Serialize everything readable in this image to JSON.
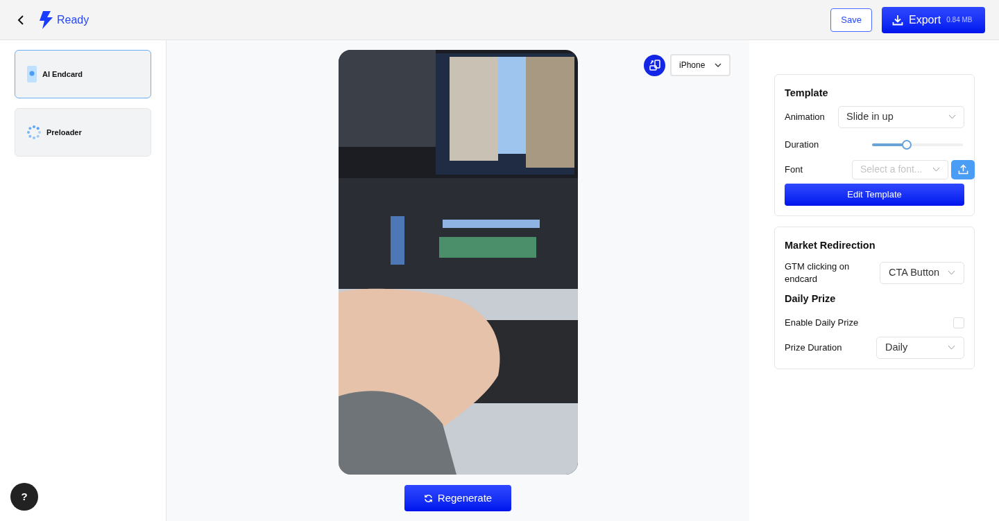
{
  "header": {
    "status": "Ready",
    "save": "Save",
    "export": {
      "label": "Export",
      "size": "0.84 MB"
    }
  },
  "sidebar": {
    "items": [
      {
        "label": "AI Endcard",
        "kind": "endcard",
        "selected": true
      },
      {
        "label": "Preloader",
        "kind": "preloader",
        "selected": false
      }
    ]
  },
  "preview": {
    "device": "iPhone",
    "regenerate": "Regenerate"
  },
  "template": {
    "title": "Template",
    "animation": {
      "label": "Animation",
      "value": "Slide in up"
    },
    "duration": {
      "label": "Duration",
      "level": 0.37
    },
    "font": {
      "label": "Font",
      "placeholder": "Select a font..."
    },
    "edit": "Edit Template"
  },
  "market": {
    "title": "Market Redirection",
    "gtm": {
      "label": "GTM clicking on endcard",
      "value": "CTA Button"
    }
  },
  "daily_prize": {
    "title": "Daily Prize",
    "enable": {
      "label": "Enable Daily Prize",
      "checked": false
    },
    "duration": {
      "label": "Prize Duration",
      "value": "Daily"
    }
  },
  "help": "?"
}
